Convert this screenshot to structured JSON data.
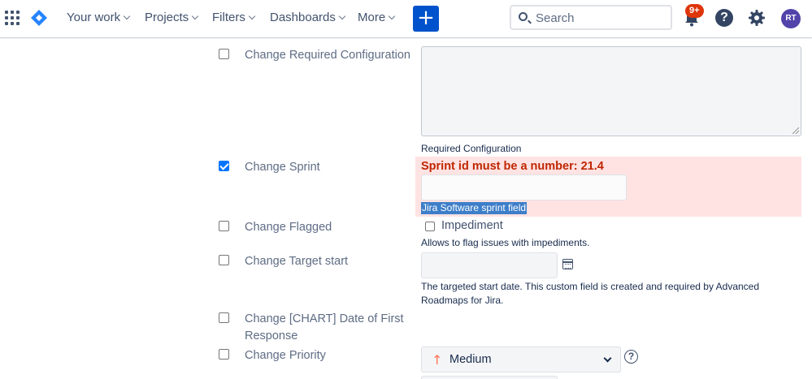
{
  "nav": {
    "items": [
      {
        "label": "Your work"
      },
      {
        "label": "Projects"
      },
      {
        "label": "Filters"
      },
      {
        "label": "Dashboards"
      },
      {
        "label": "More"
      }
    ],
    "create_label": "+",
    "search_placeholder": "Search",
    "notification_count": "9+",
    "help_label": "?",
    "avatar_initials": "RT",
    "accent_color": "#0052cc"
  },
  "form": {
    "required_config": {
      "label": "Change Required Configuration",
      "checked": false,
      "hint": "Required Configuration"
    },
    "sprint": {
      "label": "Change Sprint",
      "checked": true,
      "error": "Sprint id must be a number: 21.4",
      "hint": "Jira Software sprint field"
    },
    "flagged": {
      "label": "Change Flagged",
      "checked": false,
      "option_label": "Impediment",
      "hint": "Allows to flag issues with impediments."
    },
    "target_start": {
      "label": "Change Target start",
      "checked": false,
      "hint_line1": "The targeted start date. This custom field is created and required by Advanced",
      "hint_line2": "Roadmaps for Jira."
    },
    "chart_date": {
      "label_line1": "Change [CHART] Date of First",
      "label_line2": "Response",
      "checked": false
    },
    "priority": {
      "label": "Change Priority",
      "checked": false,
      "value": "Medium",
      "help_label": "?"
    }
  }
}
